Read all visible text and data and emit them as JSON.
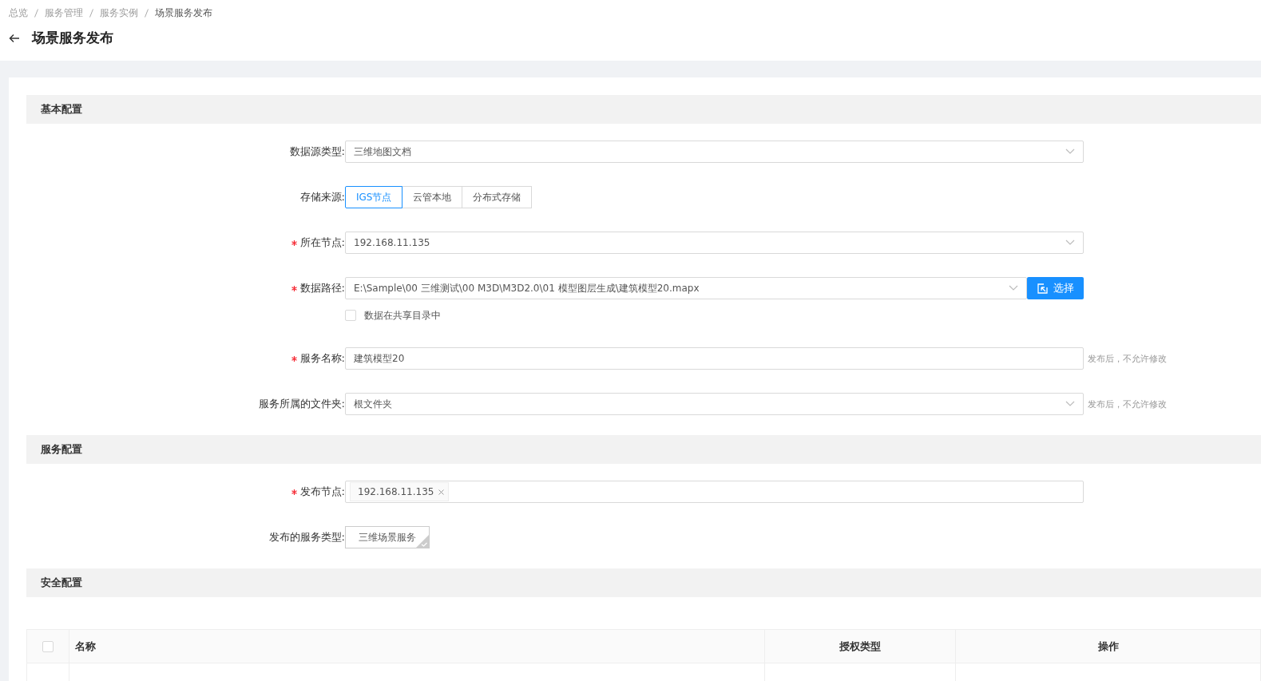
{
  "breadcrumb": [
    {
      "label": "总览"
    },
    {
      "label": "服务管理"
    },
    {
      "label": "服务实例"
    },
    {
      "label": "场景服务发布"
    }
  ],
  "title": "场景服务发布",
  "sections": [
    {
      "title": "基本配置",
      "fields": [
        {
          "kind": "select",
          "label": "数据源类型:",
          "required": false,
          "value": "三维地图文档"
        },
        {
          "kind": "segmented",
          "label": "存储来源:",
          "required": false,
          "options": [
            {
              "label": "IGS节点",
              "selected": true
            },
            {
              "label": "云管本地",
              "selected": false
            },
            {
              "label": "分布式存储",
              "selected": false
            }
          ]
        },
        {
          "kind": "select",
          "label": "所在节点:",
          "required": true,
          "value": "192.168.11.135"
        },
        {
          "kind": "path",
          "label": "数据路径:",
          "required": true,
          "value": "E:\\Sample\\00 三维测试\\00 M3D\\M3D2.0\\01 模型图层生成\\建筑模型20.mapx",
          "button": "选择",
          "checkbox": {
            "label": "数据在共享目录中",
            "checked": false
          }
        },
        {
          "kind": "input",
          "label": "服务名称:",
          "required": true,
          "value": "建筑模型20",
          "hint": "发布后，不允许修改"
        },
        {
          "kind": "select",
          "label": "服务所属的文件夹:",
          "required": false,
          "value": "根文件夹",
          "hint": "发布后，不允许修改"
        }
      ]
    },
    {
      "title": "服务配置",
      "fields": [
        {
          "kind": "tags",
          "label": "发布节点:",
          "required": true,
          "tags": [
            "192.168.11.135"
          ]
        },
        {
          "kind": "tile",
          "label": "发布的服务类型:",
          "required": false,
          "tiles": [
            {
              "label": "三维场景服务",
              "selected": true
            }
          ]
        }
      ]
    },
    {
      "title": "安全配置",
      "table": {
        "select_all": {
          "checked": false
        },
        "columns": [
          "名称",
          "授权类型",
          "操作"
        ]
      }
    }
  ]
}
